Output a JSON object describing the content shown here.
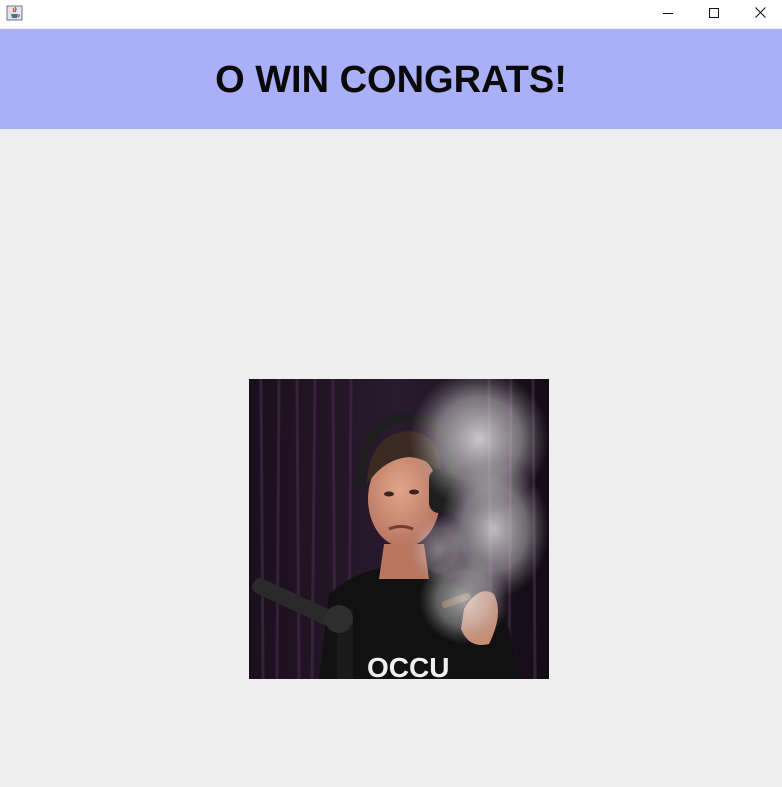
{
  "window": {
    "icon": "java-cup-icon",
    "controls": {
      "minimize_icon": "minimize-icon",
      "maximize_icon": "maximize-icon",
      "close_icon": "close-icon"
    }
  },
  "banner": {
    "title": "O WIN CONGRATS!",
    "background": "#aab0f8",
    "text_color": "#0a0a0a"
  },
  "content": {
    "background": "#eeeeee",
    "picture": {
      "subject": "photo-of-man-smoking-at-microphone",
      "caption_fragment": "OCCU"
    }
  }
}
